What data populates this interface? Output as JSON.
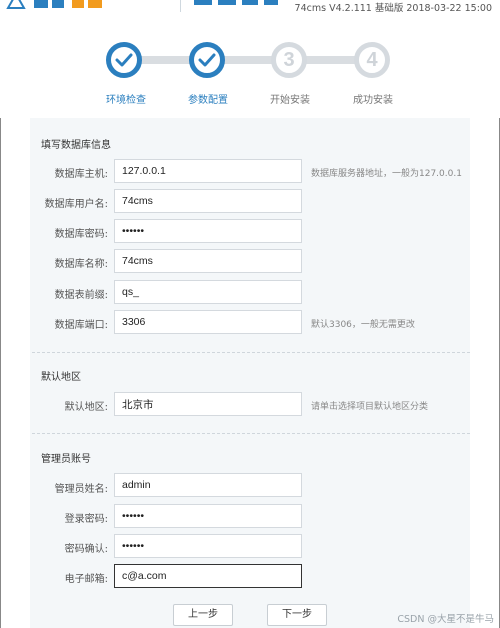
{
  "header": {
    "version_text": "74cms V4.2.111 基础版 2018-03-22 15:00"
  },
  "steps": [
    {
      "label": "环境检查",
      "status": "done"
    },
    {
      "label": "参数配置",
      "status": "done"
    },
    {
      "label": "开始安装",
      "status": "todo",
      "number": "3"
    },
    {
      "label": "成功安装",
      "status": "todo",
      "number": "4"
    }
  ],
  "db_section": {
    "title": "填写数据库信息",
    "fields": [
      {
        "label": "数据库主机:",
        "value": "127.0.0.1",
        "hint": "数据库服务器地址，一般为127.0.0.1"
      },
      {
        "label": "数据库用户名:",
        "value": "74cms",
        "hint": ""
      },
      {
        "label": "数据库密码:",
        "value": "••••••",
        "hint": ""
      },
      {
        "label": "数据库名称:",
        "value": "74cms",
        "hint": ""
      },
      {
        "label": "数据表前缀:",
        "value": "qs_",
        "hint": ""
      },
      {
        "label": "数据库端口:",
        "value": "3306",
        "hint": "默认3306，一般无需更改"
      }
    ]
  },
  "region_section": {
    "title": "默认地区",
    "field": {
      "label": "默认地区:",
      "value": "北京市",
      "hint": "请单击选择项目默认地区分类"
    }
  },
  "admin_section": {
    "title": "管理员账号",
    "fields": [
      {
        "label": "管理员姓名:",
        "value": "admin"
      },
      {
        "label": "登录密码:",
        "value": "••••••"
      },
      {
        "label": "密码确认:",
        "value": "••••••"
      },
      {
        "label": "电子邮箱:",
        "value": "c@a.com"
      }
    ]
  },
  "buttons": {
    "prev": "上一步",
    "next": "下一步"
  },
  "watermark": "CSDN @大星不是牛马",
  "colors": {
    "accent": "#2b7fbf",
    "step_done_border": "#2b7fbf",
    "step_todo": "#d5dadf",
    "panel_bg": "#f4f7f9"
  }
}
